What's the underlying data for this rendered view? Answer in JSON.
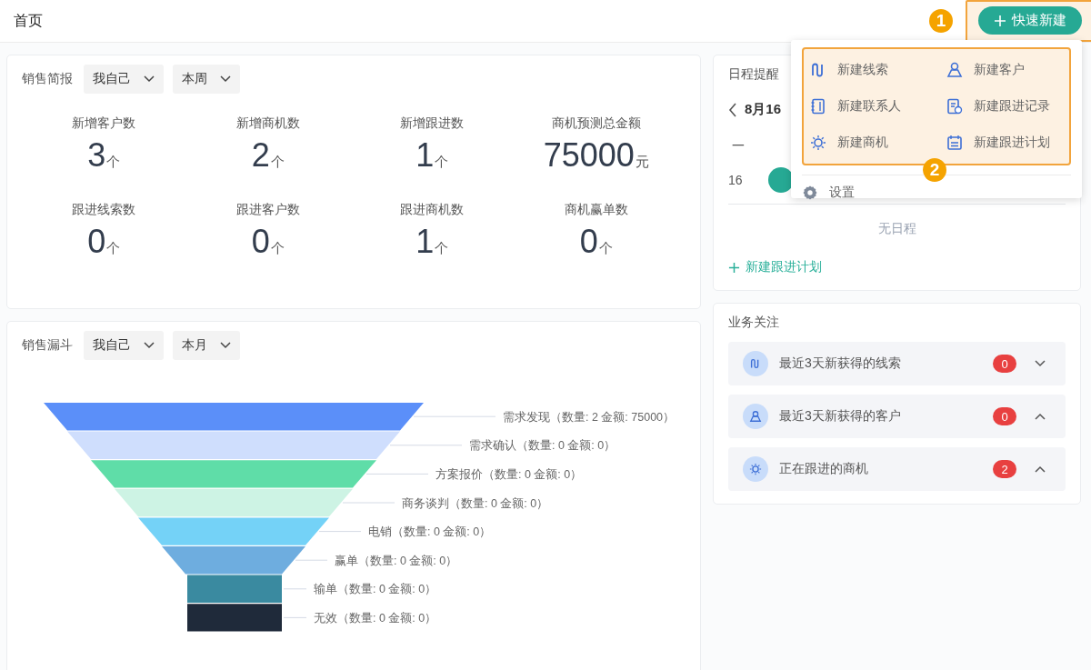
{
  "header": {
    "title": "首页",
    "quick_create": "快速新建"
  },
  "annotations": [
    {
      "label": "1"
    },
    {
      "label": "2"
    }
  ],
  "quick_menu": {
    "items": [
      {
        "label": "新建线索"
      },
      {
        "label": "新建客户"
      },
      {
        "label": "新建联系人"
      },
      {
        "label": "新建跟进记录"
      },
      {
        "label": "新建商机"
      },
      {
        "label": "新建跟进计划"
      }
    ],
    "settings": "设置"
  },
  "sales_brief": {
    "title": "销售简报",
    "filters": [
      {
        "value": "我自己"
      },
      {
        "value": "本周"
      }
    ],
    "stats": [
      {
        "label": "新增客户数",
        "value": "3",
        "unit": "个"
      },
      {
        "label": "新增商机数",
        "value": "2",
        "unit": "个"
      },
      {
        "label": "新增跟进数",
        "value": "1",
        "unit": "个"
      },
      {
        "label": "商机预测总金额",
        "value": "75000",
        "unit": "元"
      },
      {
        "label": "跟进线索数",
        "value": "0",
        "unit": "个"
      },
      {
        "label": "跟进客户数",
        "value": "0",
        "unit": "个"
      },
      {
        "label": "跟进商机数",
        "value": "1",
        "unit": "个"
      },
      {
        "label": "商机赢单数",
        "value": "0",
        "unit": "个"
      }
    ]
  },
  "sales_funnel": {
    "title": "销售漏斗",
    "filters": [
      {
        "value": "我自己"
      },
      {
        "value": "本月"
      }
    ],
    "stages": [
      {
        "label": "需求发现（数量: 2 金额: 75000）",
        "color": "#5b8ff9"
      },
      {
        "label": "需求确认（数量: 0 金额: 0）",
        "color": "#cfdefd"
      },
      {
        "label": "方案报价（数量: 0 金额: 0）",
        "color": "#5fdda8"
      },
      {
        "label": "商务谈判（数量: 0 金额: 0）",
        "color": "#cdf3e4"
      },
      {
        "label": "电销（数量: 0 金额: 0）",
        "color": "#74d2f7"
      },
      {
        "label": "赢单（数量: 0 金额: 0）",
        "color": "#6eaddf"
      },
      {
        "label": "输单（数量: 0 金额: 0）",
        "color": "#3a8aa0"
      },
      {
        "label": "无效（数量: 0 金额: 0）",
        "color": "#1f2a3a"
      }
    ]
  },
  "schedule": {
    "title": "日程提醒",
    "date": "8月16",
    "weekday": "一",
    "day": "16",
    "empty": "无日程",
    "add": "新建跟进计划"
  },
  "focus": {
    "title": "业务关注",
    "items": [
      {
        "label": "最近3天新获得的线索",
        "count": "0",
        "expanded": false
      },
      {
        "label": "最近3天新获得的客户",
        "count": "0",
        "expanded": true
      },
      {
        "label": "正在跟进的商机",
        "count": "2",
        "expanded": true
      }
    ]
  }
}
